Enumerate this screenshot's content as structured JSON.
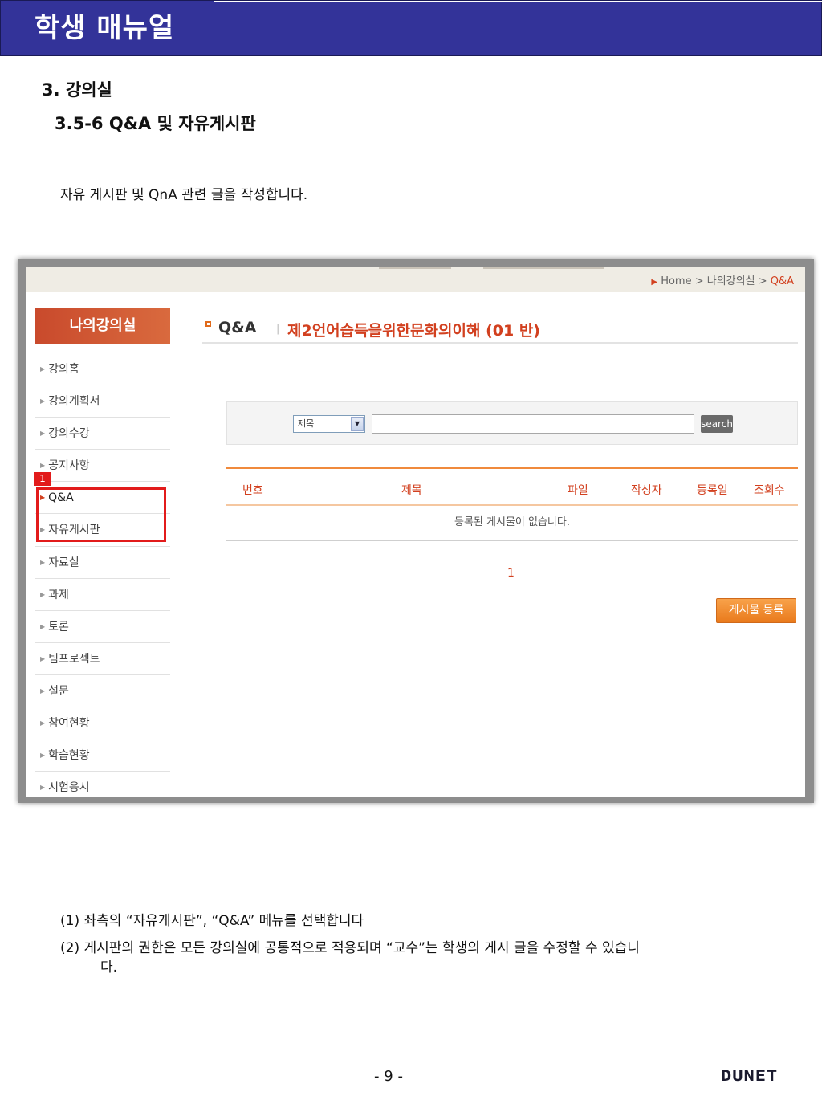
{
  "header": {
    "title": "학생 매뉴얼"
  },
  "section": {
    "title": "3. 강의실",
    "subtitle": "3.5-6 Q&A 및 자유게시판"
  },
  "intro": "자유 게시판 및 QnA 관련 글을 작성합니다.",
  "screenshot": {
    "breadcrumb": [
      "Home",
      "나의강의실",
      "Q&A"
    ],
    "menu_title": "나의강의실",
    "menu_items": [
      {
        "label": "강의홈"
      },
      {
        "label": "강의계획서"
      },
      {
        "label": "강의수강"
      },
      {
        "label": "공지사항"
      },
      {
        "label": "Q&A"
      },
      {
        "label": "자유게시판"
      },
      {
        "label": "자료실"
      },
      {
        "label": "과제"
      },
      {
        "label": "토론"
      },
      {
        "label": "팀프로젝트"
      },
      {
        "label": "설문"
      },
      {
        "label": "참여현황"
      },
      {
        "label": "학습현황"
      },
      {
        "label": "시험응시"
      }
    ],
    "highlight_tag": "1",
    "board_name": "Q&A",
    "separator": "|",
    "course_name": "제2언어습득을위한문화의이해 (01 반)",
    "search": {
      "select_value": "제목",
      "button": "search"
    },
    "table": {
      "headers": [
        "번호",
        "제목",
        "파일",
        "작성자",
        "등록일",
        "조회수"
      ],
      "empty_message": "등록된 게시물이 없습니다."
    },
    "pager": "1",
    "write_button": "게시물 등록"
  },
  "notes": [
    {
      "marker": "(1)",
      "text": "좌측의 “자유게시판”, “Q&A” 메뉴를 선택합니다"
    },
    {
      "marker": "(2)",
      "text": "게시판의 권한은 모든 강의실에 공통적으로 적용되며 “교수”는 학생의 게시 글을 수정할 수 있습니",
      "continuation": "다."
    }
  ],
  "footer": {
    "page": "- 9 -",
    "logo": "DUNET"
  },
  "colors": {
    "header_bg": "#333399",
    "accent": "#d2401f",
    "highlight": "#e21b1b"
  }
}
